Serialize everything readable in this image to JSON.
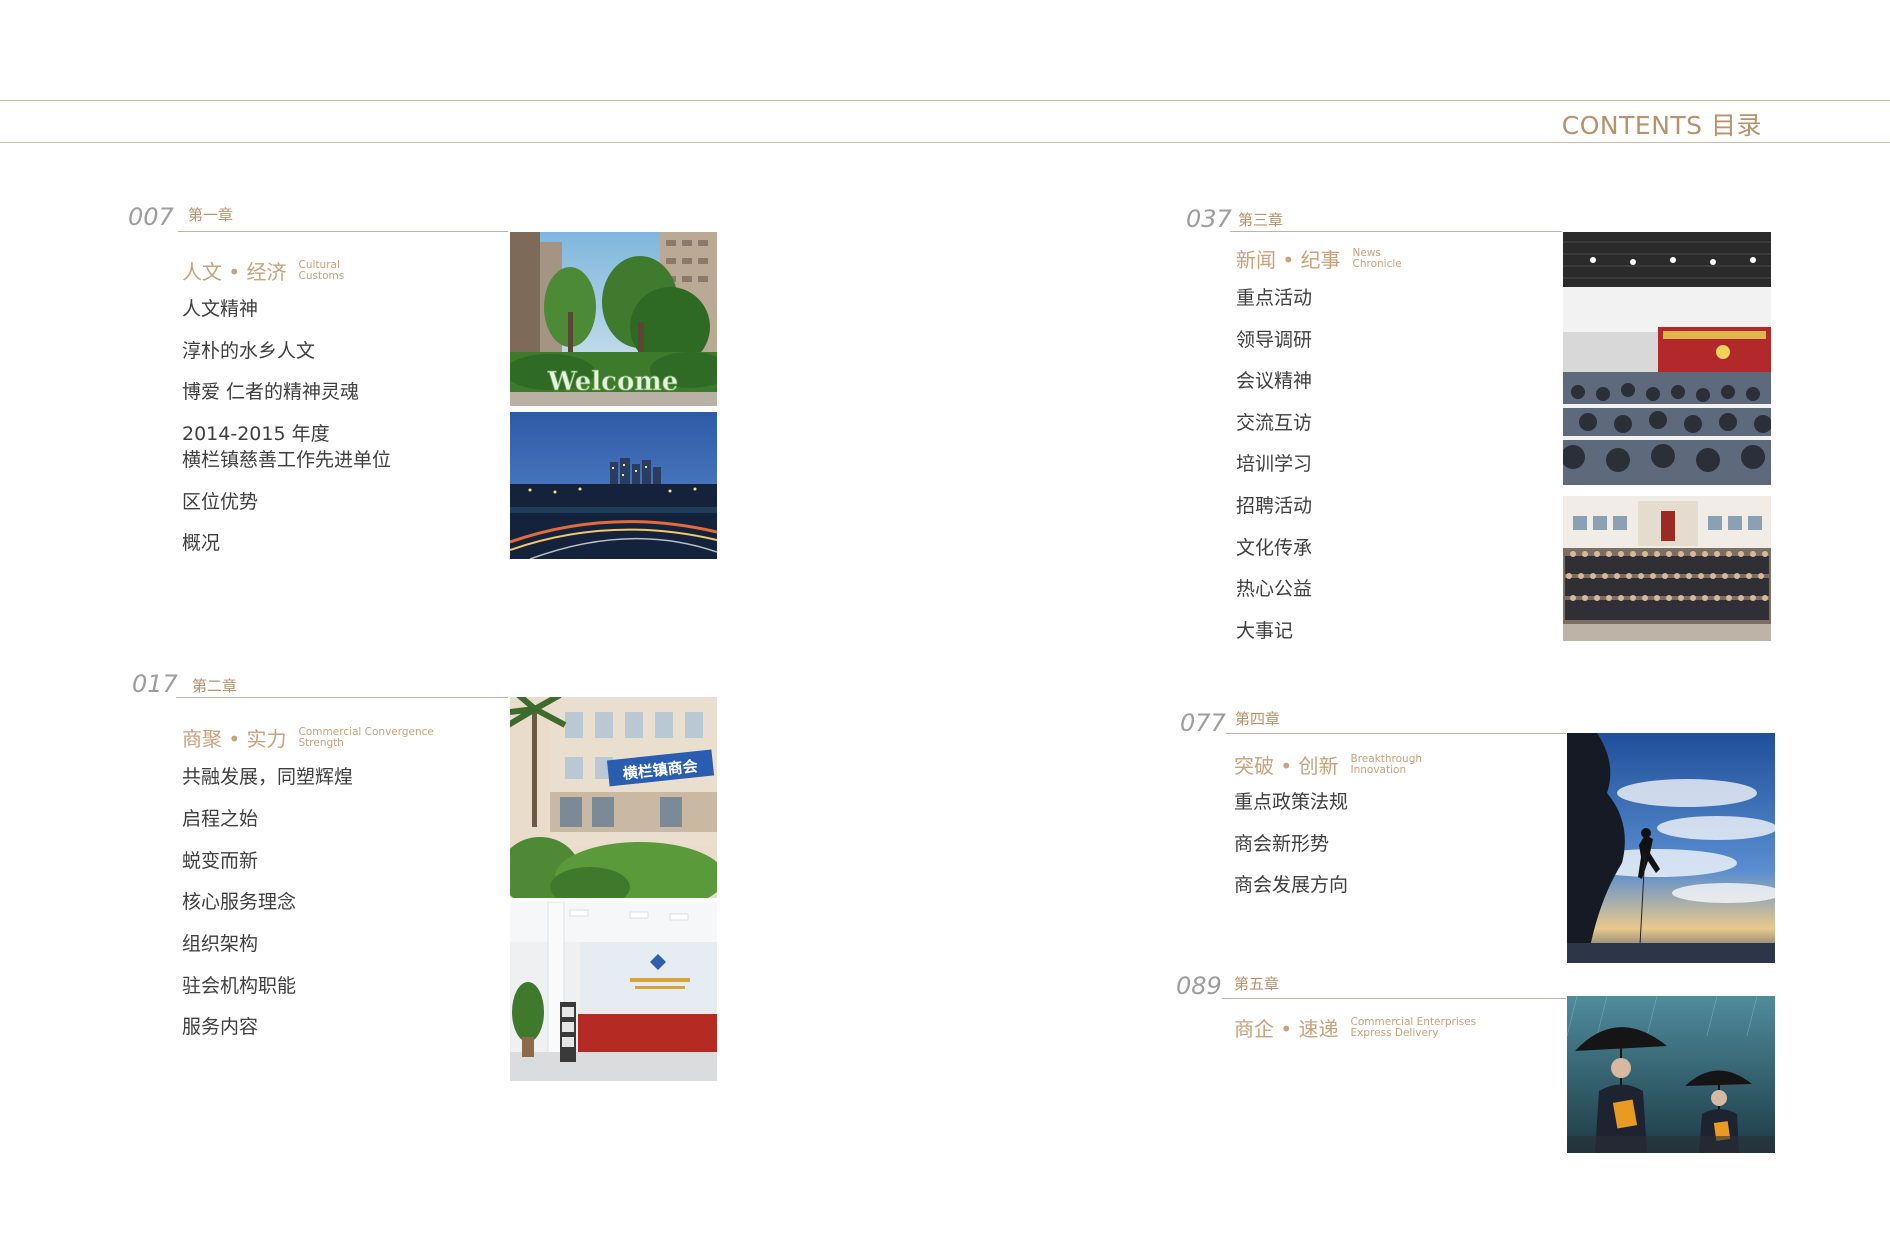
{
  "header": {
    "title": "CONTENTS 目录"
  },
  "chapters": {
    "c1": {
      "number": "007",
      "label": "第一章",
      "section_zh": "人文 • 经济",
      "section_en_1": "Cultural",
      "section_en_2": "Customs",
      "items": [
        "人文精神",
        "淳朴的水乡人文",
        "博爱 仁者的精神灵魂",
        "2014-2015 年度",
        "横栏镇慈善工作先进单位",
        "区位优势",
        "概况"
      ]
    },
    "c2": {
      "number": "017",
      "label": "第二章",
      "section_zh": "商聚 • 实力",
      "section_en_1": "Commercial Convergence",
      "section_en_2": "Strength",
      "items": [
        "共融发展，同塑辉煌",
        "启程之始",
        "蜕变而新",
        "核心服务理念",
        "组织架构",
        "驻会机构职能",
        "服务内容"
      ]
    },
    "c3": {
      "number": "037",
      "label": "第三章",
      "section_zh": "新闻 • 纪事",
      "section_en_1": "News",
      "section_en_2": "Chronicle",
      "items": [
        "重点活动",
        "领导调研",
        "会议精神",
        "交流互访",
        "培训学习",
        "招聘活动",
        "文化传承",
        "热心公益",
        "大事记"
      ]
    },
    "c4": {
      "number": "077",
      "label": "第四章",
      "section_zh": "突破 • 创新",
      "section_en_1": "Breakthrough",
      "section_en_2": "Innovation",
      "items": [
        "重点政策法规",
        "商会新形势",
        "商会发展方向"
      ]
    },
    "c5": {
      "number": "089",
      "label": "第五章",
      "section_zh": "商企 • 速递",
      "section_en_1": "Commercial Enterprises",
      "section_en_2": "Express Delivery"
    }
  },
  "photos": {
    "welcome_sign_text": "Welcome",
    "chamber_sign_text": "横栏镇商会"
  },
  "colors": {
    "accent": "#b8926a",
    "accent_light": "#c9a27c",
    "text": "#3f3f3f",
    "rule": "#cbb9a6",
    "number": "#9d9d9d"
  }
}
